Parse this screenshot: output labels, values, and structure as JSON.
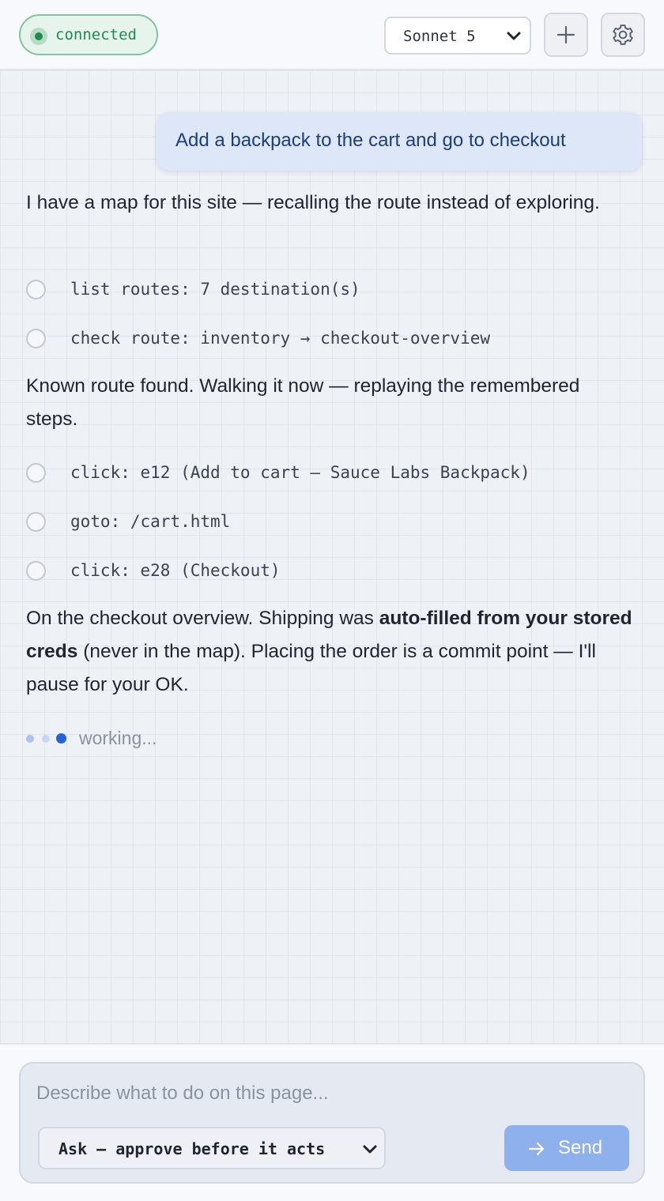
{
  "header": {
    "status": "connected",
    "model": "Sonnet 5",
    "new_chat_icon": "plus-icon",
    "settings_icon": "gear-icon"
  },
  "chat": {
    "user_message": "Add a backpack to the cart and go to checkout",
    "para1": "I have a map for this site — recalling the route instead of exploring.",
    "steps_group1": [
      "list routes: 7 destination(s)",
      "check route: inventory → checkout-overview"
    ],
    "para2": "Known route found. Walking it now — replaying the remembered steps.",
    "steps_group2": [
      "click: e12 (Add to cart — Sauce Labs Backpack)",
      "goto: /cart.html",
      "click: e28 (Checkout)"
    ],
    "para3": {
      "before": "On the checkout overview. Shipping was ",
      "bold": "auto-filled from your stored creds",
      "after": " (never in the map). Placing the order is a commit point — I'll pause for your OK."
    },
    "working": "working..."
  },
  "composer": {
    "placeholder": "Describe what to do on this page...",
    "mode": "Ask — approve before it acts",
    "send_label": "Send"
  },
  "colors": {
    "accent": "#2563d9",
    "connected": "#1f8a4c",
    "user_bubble": "#dde7f8",
    "send_button": "#8eb0ec"
  }
}
